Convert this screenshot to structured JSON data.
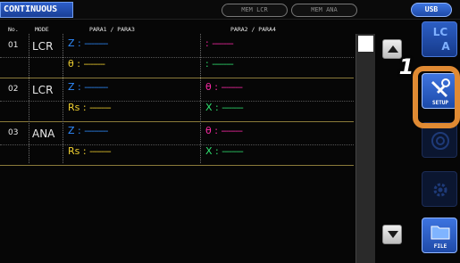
{
  "topbar": {
    "title": "CONTINUOUS",
    "mem_lcr": "MEM LCR",
    "mem_ana": "MEM ANA",
    "usb": "USB"
  },
  "table": {
    "headers": {
      "no": "No.",
      "mode": "MODE",
      "para13": "PARA1 / PARA3",
      "para24": "PARA2 / PARA4"
    },
    "rows": [
      {
        "num": "01",
        "mode": "LCR",
        "p1": {
          "label": "Z",
          "sep": ":",
          "value": "----------"
        },
        "p3": {
          "label": "θ",
          "sep": ":",
          "value": "---------"
        },
        "p2": {
          "label": "",
          "sep": ":",
          "value": "---------"
        },
        "p4": {
          "label": "",
          "sep": ":",
          "value": "---------"
        }
      },
      {
        "num": "02",
        "mode": "LCR",
        "p1": {
          "label": "Z",
          "sep": ":",
          "value": "----------"
        },
        "p3": {
          "label": "Rs",
          "sep": ":",
          "value": "---------"
        },
        "p2": {
          "label": "θ",
          "sep": ":",
          "value": "---------"
        },
        "p4": {
          "label": "X",
          "sep": ":",
          "value": "---------"
        }
      },
      {
        "num": "03",
        "mode": "ANA",
        "p1": {
          "label": "Z",
          "sep": ":",
          "value": "----------"
        },
        "p3": {
          "label": "Rs",
          "sep": ":",
          "value": "---------"
        },
        "p2": {
          "label": "θ",
          "sep": ":",
          "value": "---------"
        },
        "p4": {
          "label": "X",
          "sep": ":",
          "value": "---------"
        }
      }
    ]
  },
  "side": {
    "lcr_ana_top": "LC",
    "lcr_ana_bottom": "A",
    "setup": "SETUP",
    "file": "FILE"
  },
  "annotation": {
    "step": "1"
  },
  "colors": {
    "para1": "#2f8cff",
    "para2": "#ff2aa8",
    "para3": "#f0d030",
    "para4": "#30e070",
    "highlight": "#e08a33"
  },
  "icons": [
    "up-arrow-icon",
    "down-arrow-icon",
    "wrench-icon",
    "gear-icon",
    "folder-icon"
  ]
}
